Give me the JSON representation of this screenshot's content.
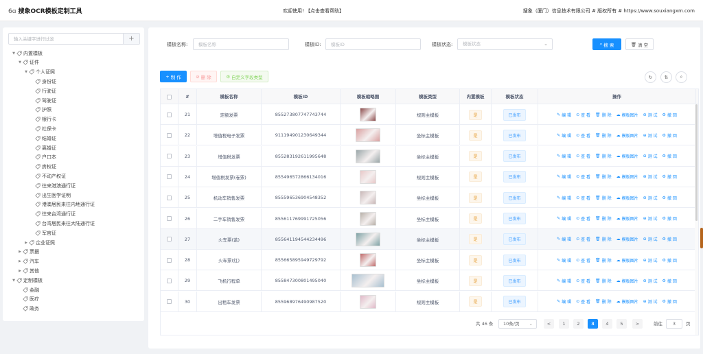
{
  "topbar": {
    "logo_mark": "6ɑ",
    "title": "搜象OCR模板定制工具",
    "welcome": "欢迎使用! 【点击查看帮助】",
    "copyright": "搜象（厦门）信息技术有限公司 # 版权所有 # https://www.souxiangxm.com"
  },
  "sidebar": {
    "filter_placeholder": "输入关键字进行过滤",
    "add_label": "+",
    "tree": [
      {
        "label": "内置模板",
        "arrow": "▼"
      },
      {
        "label": "证件",
        "arrow": "▼"
      },
      {
        "label": "个人证照",
        "arrow": "▼"
      },
      {
        "label": "身份证",
        "arrow": ""
      },
      {
        "label": "行驶证",
        "arrow": ""
      },
      {
        "label": "驾驶证",
        "arrow": ""
      },
      {
        "label": "护照",
        "arrow": ""
      },
      {
        "label": "银行卡",
        "arrow": ""
      },
      {
        "label": "社保卡",
        "arrow": ""
      },
      {
        "label": "结婚证",
        "arrow": ""
      },
      {
        "label": "离婚证",
        "arrow": ""
      },
      {
        "label": "户口本",
        "arrow": ""
      },
      {
        "label": "房权证",
        "arrow": ""
      },
      {
        "label": "不动产权证",
        "arrow": ""
      },
      {
        "label": "往来港澳通行证",
        "arrow": ""
      },
      {
        "label": "出生医学证明",
        "arrow": ""
      },
      {
        "label": "港澳居民来往内地通行证",
        "arrow": ""
      },
      {
        "label": "往来台湾通行证",
        "arrow": ""
      },
      {
        "label": "台湾居民来往大陆通行证",
        "arrow": ""
      },
      {
        "label": "军官证",
        "arrow": ""
      },
      {
        "label": "企业证照",
        "arrow": "▶"
      },
      {
        "label": "票据",
        "arrow": "▶"
      },
      {
        "label": "汽车",
        "arrow": "▶"
      },
      {
        "label": "其他",
        "arrow": "▶"
      },
      {
        "label": "定制模板",
        "arrow": "▼"
      },
      {
        "label": "金融",
        "arrow": ""
      },
      {
        "label": "医疗",
        "arrow": ""
      },
      {
        "label": "政务",
        "arrow": ""
      }
    ]
  },
  "search": {
    "name_label": "模板名称:",
    "name_placeholder": "模板名称",
    "id_label": "模板ID:",
    "id_placeholder": "模板ID",
    "status_label": "模板状态:",
    "status_placeholder": "模板状态",
    "search_button": "搜 索",
    "reset_button": "清 空"
  },
  "toolbar": {
    "create_button": "制 作",
    "delete_button": "删 除",
    "custom_type_button": "自定义字段类型"
  },
  "table": {
    "headers": [
      "",
      "#",
      "模板名称",
      "模板ID",
      "模板缩略图",
      "模板类型",
      "内置模板",
      "模板状态",
      "操作"
    ],
    "ops": [
      "编 辑",
      "查 看",
      "删 除",
      "模板图片",
      "测 试",
      "撤 回"
    ],
    "rows": [
      {
        "num": "21",
        "name": "定额发票",
        "id": "855273807747743744",
        "type": "规则主模板",
        "builtin": "是",
        "status": "已发布",
        "thumb_color": "#8b4a4a"
      },
      {
        "num": "22",
        "name": "增值税电子发票",
        "id": "911194901230649344",
        "type": "坐标主模板",
        "builtin": "是",
        "status": "已发布",
        "thumb_color": "#d9a0a0"
      },
      {
        "num": "23",
        "name": "增值税发票",
        "id": "855283192611995648",
        "type": "坐标主模板",
        "builtin": "是",
        "status": "已发布",
        "thumb_color": "#9aa6a8"
      },
      {
        "num": "24",
        "name": "增值税发票(卷票)",
        "id": "855496572866134016",
        "type": "规则主模板",
        "builtin": "是",
        "status": "已发布",
        "thumb_color": "#e8c8c8"
      },
      {
        "num": "25",
        "name": "机动车销售发票",
        "id": "855596536904548352",
        "type": "坐标主模板",
        "builtin": "是",
        "status": "已发布",
        "thumb_color": "#c9b7b7"
      },
      {
        "num": "26",
        "name": "二手车销售发票",
        "id": "855611769991725056",
        "type": "坐标主模板",
        "builtin": "是",
        "status": "已发布",
        "thumb_color": "#b8b0a8"
      },
      {
        "num": "27",
        "name": "火车票(蓝)",
        "id": "855641194544234496",
        "type": "坐标主模板",
        "builtin": "是",
        "status": "已发布",
        "thumb_color": "#7fa3a6"
      },
      {
        "num": "28",
        "name": "火车票(红)",
        "id": "855665895949729792",
        "type": "坐标主模板",
        "builtin": "是",
        "status": "已发布",
        "thumb_color": "#c06a6a"
      },
      {
        "num": "29",
        "name": "飞机行程单",
        "id": "855847300801495040",
        "type": "坐标主模板",
        "builtin": "是",
        "status": "已发布",
        "thumb_color": "#a8c0d0"
      },
      {
        "num": "30",
        "name": "出租车发票",
        "id": "855968976490987520",
        "type": "规则主模板",
        "builtin": "是",
        "status": "已发布",
        "thumb_color": "#e0b8c8"
      }
    ]
  },
  "pagination": {
    "total": "共 46 条",
    "page_size": "10条/页",
    "prev": "<",
    "next": ">",
    "pages": [
      "1",
      "2",
      "3",
      "4",
      "5"
    ],
    "current": "3",
    "goto_label": "前往",
    "goto_value": "3",
    "goto_unit": "页"
  },
  "colors": {
    "primary": "#1890ff",
    "warning": "#e6a23c",
    "danger": "#f56c6c",
    "success": "#52c41a"
  }
}
